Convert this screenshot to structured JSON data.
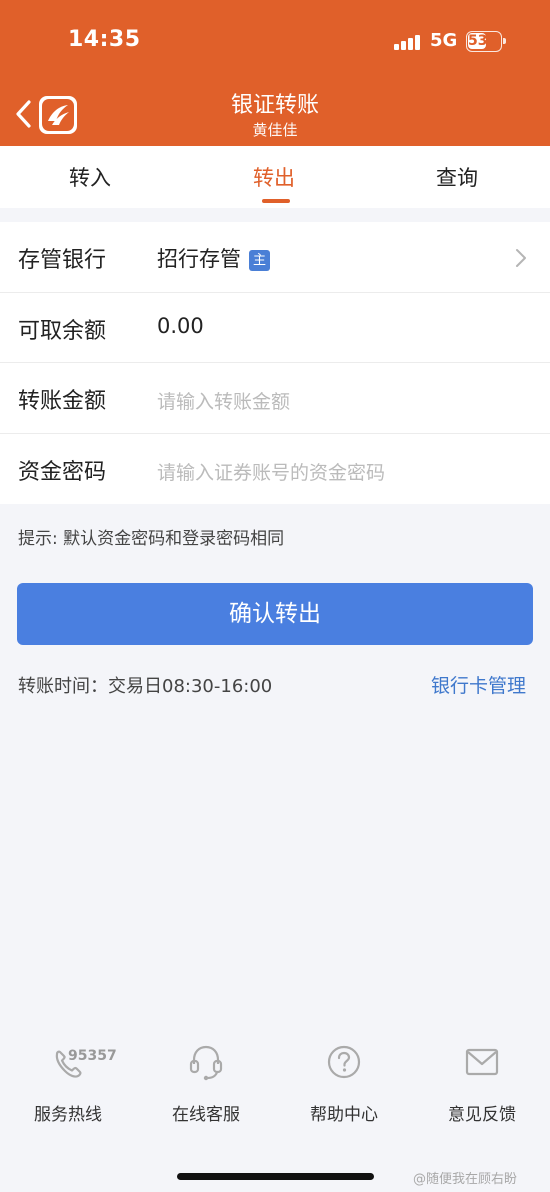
{
  "status_bar": {
    "time": "14:35",
    "network": "5G",
    "battery": "53"
  },
  "header": {
    "title": "银证转账",
    "subtitle": "黄佳佳"
  },
  "tabs": [
    {
      "label": "转入",
      "active": false
    },
    {
      "label": "转出",
      "active": true
    },
    {
      "label": "查询",
      "active": false
    }
  ],
  "form": {
    "bank": {
      "label": "存管银行",
      "value": "招行存管",
      "badge": "主"
    },
    "balance": {
      "label": "可取余额",
      "value": "0.00"
    },
    "amount": {
      "label": "转账金额",
      "placeholder": "请输入转账金额"
    },
    "password": {
      "label": "资金密码",
      "placeholder": "请输入证券账号的资金密码"
    }
  },
  "hint": "提示: 默认资金密码和登录密码相同",
  "confirm_button": "确认转出",
  "transfer_time": "转账时间：交易日08:30-16:00",
  "bank_card_manage": "银行卡管理",
  "footer": {
    "hotline_number": "95357",
    "items": [
      {
        "label": "服务热线",
        "icon": "phone-icon"
      },
      {
        "label": "在线客服",
        "icon": "headset-icon"
      },
      {
        "label": "帮助中心",
        "icon": "question-icon"
      },
      {
        "label": "意见反馈",
        "icon": "mail-icon"
      }
    ]
  },
  "watermark": "@随便我在顾右盼",
  "colors": {
    "brand": "#e0602a",
    "primary_button": "#4a7fe0",
    "link": "#3f78cc"
  }
}
